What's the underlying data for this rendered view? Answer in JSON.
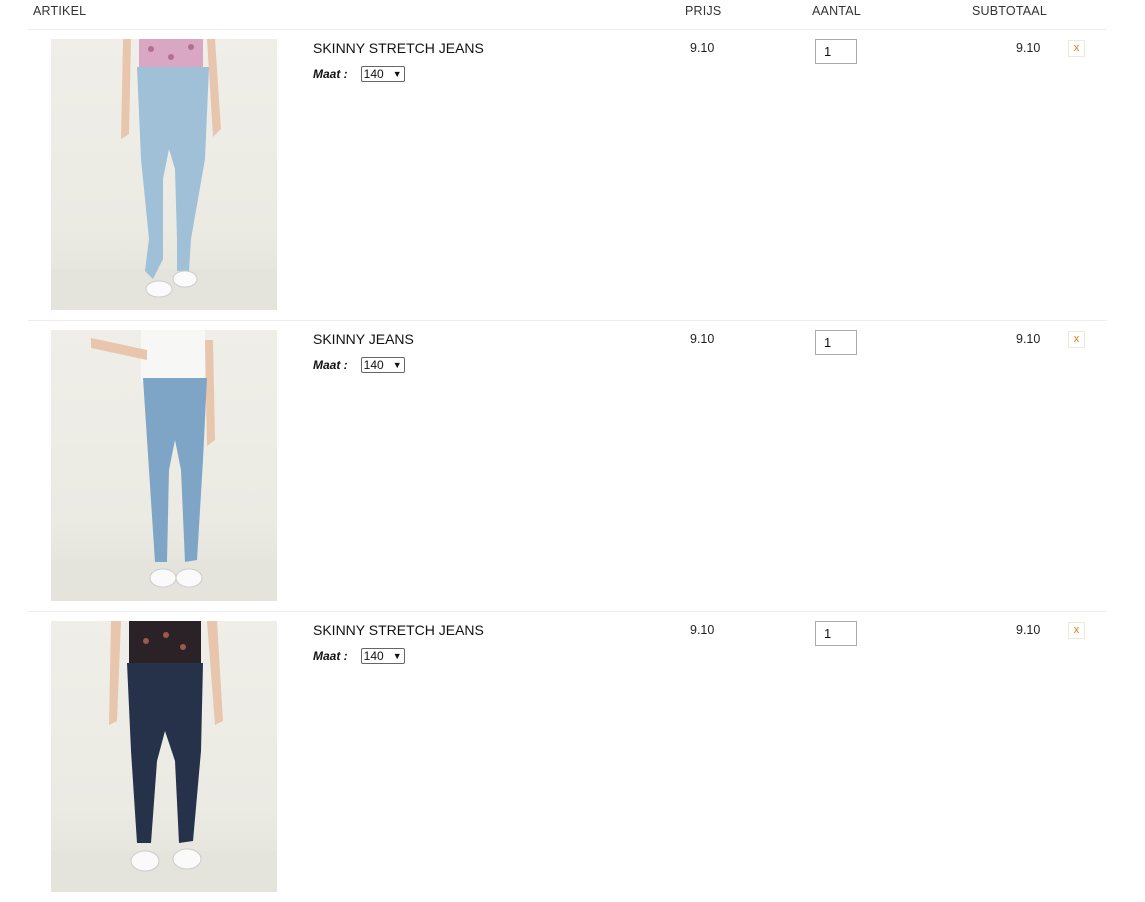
{
  "header": {
    "artikel": "ARTIKEL",
    "prijs": "PRIJS",
    "aantal": "AANTAL",
    "subtotaal": "SUBTOTAAL"
  },
  "items": [
    {
      "name": "SKINNY STRETCH JEANS",
      "size_label": "Maat :",
      "size_value": "140",
      "price": "9.10",
      "quantity": "1",
      "subtotal": "9.10",
      "remove_label": "x",
      "image": "light-blue-jeans-pink-top"
    },
    {
      "name": "SKINNY JEANS",
      "size_label": "Maat :",
      "size_value": "140",
      "price": "9.10",
      "quantity": "1",
      "subtotal": "9.10",
      "remove_label": "x",
      "image": "mid-blue-jeans-white-top"
    },
    {
      "name": "SKINNY STRETCH JEANS",
      "size_label": "Maat :",
      "size_value": "140",
      "price": "9.10",
      "quantity": "1",
      "subtotal": "9.10",
      "remove_label": "x",
      "image": "dark-blue-jeans-black-top"
    }
  ],
  "colors": {
    "remove_accent": "#e07b1a",
    "jeans_light": "#9fc0d6",
    "jeans_mid": "#7ea5c6",
    "jeans_dark": "#26324a"
  }
}
